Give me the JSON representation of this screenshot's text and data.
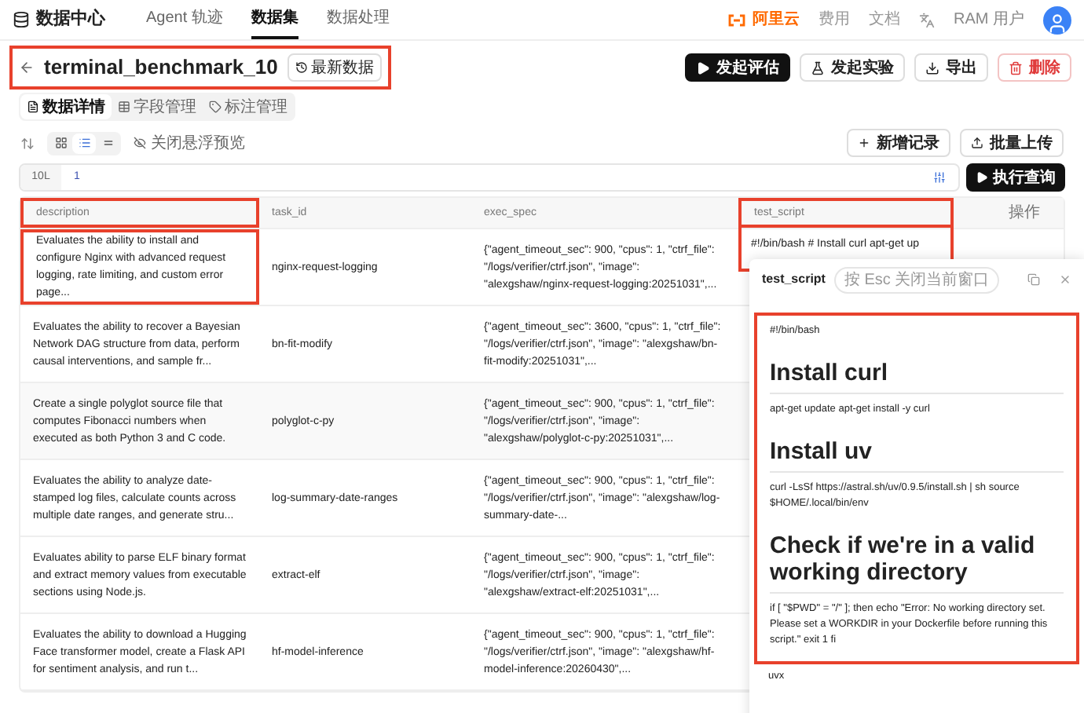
{
  "nav": {
    "title": "数据中心",
    "tabs": [
      {
        "label": "Agent 轨迹",
        "selected": false
      },
      {
        "label": "数据集",
        "selected": true
      },
      {
        "label": "数据处理",
        "selected": false
      }
    ],
    "brand": "阿里云",
    "links": [
      "费用",
      "文档"
    ],
    "user": "RAM 用户"
  },
  "header": {
    "title": "terminal_benchmark_10",
    "version_button": "最新数据",
    "actions": [
      {
        "label": "发起评估",
        "kind": "primary"
      },
      {
        "label": "发起实验",
        "kind": "experiment"
      },
      {
        "label": "导出",
        "kind": "export"
      },
      {
        "label": "删除",
        "kind": "danger"
      }
    ]
  },
  "subtabs": [
    {
      "label": "数据详情",
      "selected": true
    },
    {
      "label": "字段管理",
      "selected": false
    },
    {
      "label": "标注管理",
      "selected": false
    }
  ],
  "toolbar": {
    "view_modes": [
      {
        "selected": false
      },
      {
        "selected": true
      },
      {
        "selected": false
      }
    ],
    "preview_toggle": "关闭悬浮预览",
    "buttons": [
      "新增记录",
      "批量上传"
    ]
  },
  "query": {
    "label": "10L",
    "value": "1",
    "run_button": "执行查询"
  },
  "table": {
    "columns": [
      "description",
      "task_id",
      "exec_spec",
      "test_script",
      "操作"
    ],
    "rows": [
      {
        "description": "Evaluates the ability to install and configure Nginx with advanced request logging, rate limiting, and custom error page...",
        "task_id": "nginx-request-logging",
        "exec_spec": "{\"agent_timeout_sec\": 900, \"cpus\": 1, \"ctrf_file\": \"/logs/verifier/ctrf.json\", \"image\": \"alexgshaw/nginx-request-logging:20251031\",...",
        "test_script": "#!/bin/bash # Install curl apt-get up"
      },
      {
        "description": "Evaluates the ability to recover a Bayesian Network DAG structure from data, perform causal interventions, and sample fr...",
        "task_id": "bn-fit-modify",
        "exec_spec": "{\"agent_timeout_sec\": 3600, \"cpus\": 1, \"ctrf_file\": \"/logs/verifier/ctrf.json\", \"image\": \"alexgshaw/bn-fit-modify:20251031\",..."
      },
      {
        "description": "Create a single polyglot source file that computes Fibonacci numbers when executed as both Python 3 and C code.",
        "task_id": "polyglot-c-py",
        "exec_spec": "{\"agent_timeout_sec\": 900, \"cpus\": 1, \"ctrf_file\": \"/logs/verifier/ctrf.json\", \"image\": \"alexgshaw/polyglot-c-py:20251031\",..."
      },
      {
        "description": "Evaluates the ability to analyze date-stamped log files, calculate counts across multiple date ranges, and generate stru...",
        "task_id": "log-summary-date-ranges",
        "exec_spec": "{\"agent_timeout_sec\": 900, \"cpus\": 1, \"ctrf_file\": \"/logs/verifier/ctrf.json\", \"image\": \"alexgshaw/log-summary-date-..."
      },
      {
        "description": "Evaluates ability to parse ELF binary format and extract memory values from executable sections using Node.js.",
        "task_id": "extract-elf",
        "exec_spec": "{\"agent_timeout_sec\": 900, \"cpus\": 1, \"ctrf_file\": \"/logs/verifier/ctrf.json\", \"image\": \"alexgshaw/extract-elf:20251031\",..."
      },
      {
        "description": "Evaluates the ability to download a Hugging Face transformer model, create a Flask API for sentiment analysis, and run t...",
        "task_id": "hf-model-inference",
        "exec_spec": "{\"agent_timeout_sec\": 900, \"cpus\": 1, \"ctrf_file\": \"/logs/verifier/ctrf.json\", \"image\": \"alexgshaw/hf-model-inference:20260430\",..."
      }
    ]
  },
  "preview": {
    "title": "test_script",
    "hint": "按 Esc 关闭当前窗口",
    "blocks": [
      {
        "kind": "text",
        "text": "#!/bin/bash"
      },
      {
        "kind": "heading",
        "text": "Install curl"
      },
      {
        "kind": "text",
        "text": "apt-get update apt-get install -y curl"
      },
      {
        "kind": "heading",
        "text": "Install uv"
      },
      {
        "kind": "text",
        "text": "curl -LsSf https://astral.sh/uv/0.9.5/install.sh | sh source $HOME/.local/bin/env"
      },
      {
        "kind": "heading",
        "text": "Check if we're in a valid working directory"
      },
      {
        "kind": "text",
        "text": "if [ \"$PWD\" = \"/\" ]; then echo \"Error: No working directory set. Please set a WORKDIR in your Dockerfile before running this script.\" exit 1 fi"
      }
    ],
    "trailing": "uvx"
  }
}
